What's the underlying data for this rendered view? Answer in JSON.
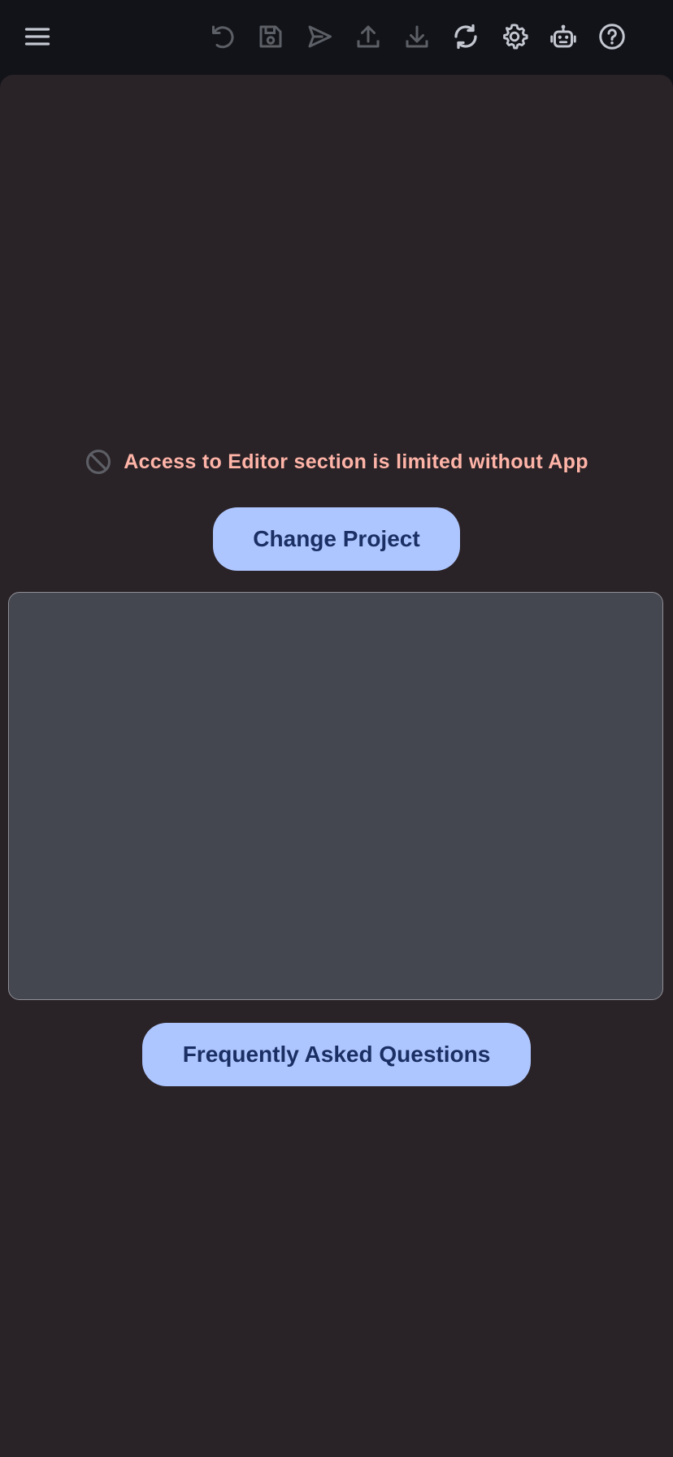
{
  "toolbar": {
    "buttons": [
      {
        "name": "menu-icon",
        "enabled": true
      },
      {
        "name": "undo-icon",
        "enabled": false
      },
      {
        "name": "save-icon",
        "enabled": false
      },
      {
        "name": "send-icon",
        "enabled": false
      },
      {
        "name": "upload-icon",
        "enabled": false
      },
      {
        "name": "download-icon",
        "enabled": false
      },
      {
        "name": "sync-icon",
        "enabled": true
      },
      {
        "name": "settings-icon",
        "enabled": true
      },
      {
        "name": "robot-icon",
        "enabled": true
      },
      {
        "name": "help-icon",
        "enabled": true
      }
    ]
  },
  "main": {
    "warning": {
      "icon": "block-icon",
      "text": "Access to Editor section is limited without App"
    },
    "change_project_label": "Change Project",
    "faq_label": "Frequently Asked Questions"
  },
  "colors": {
    "toolbar_bg": "#111318",
    "surface_bg": "#292226",
    "icon_enabled": "#c4c6d0",
    "icon_disabled": "#5d5f66",
    "warning_text": "#ffb4a8",
    "button_bg": "#aec6ff",
    "button_text": "#1a2f63",
    "panel_bg": "#44474f"
  }
}
